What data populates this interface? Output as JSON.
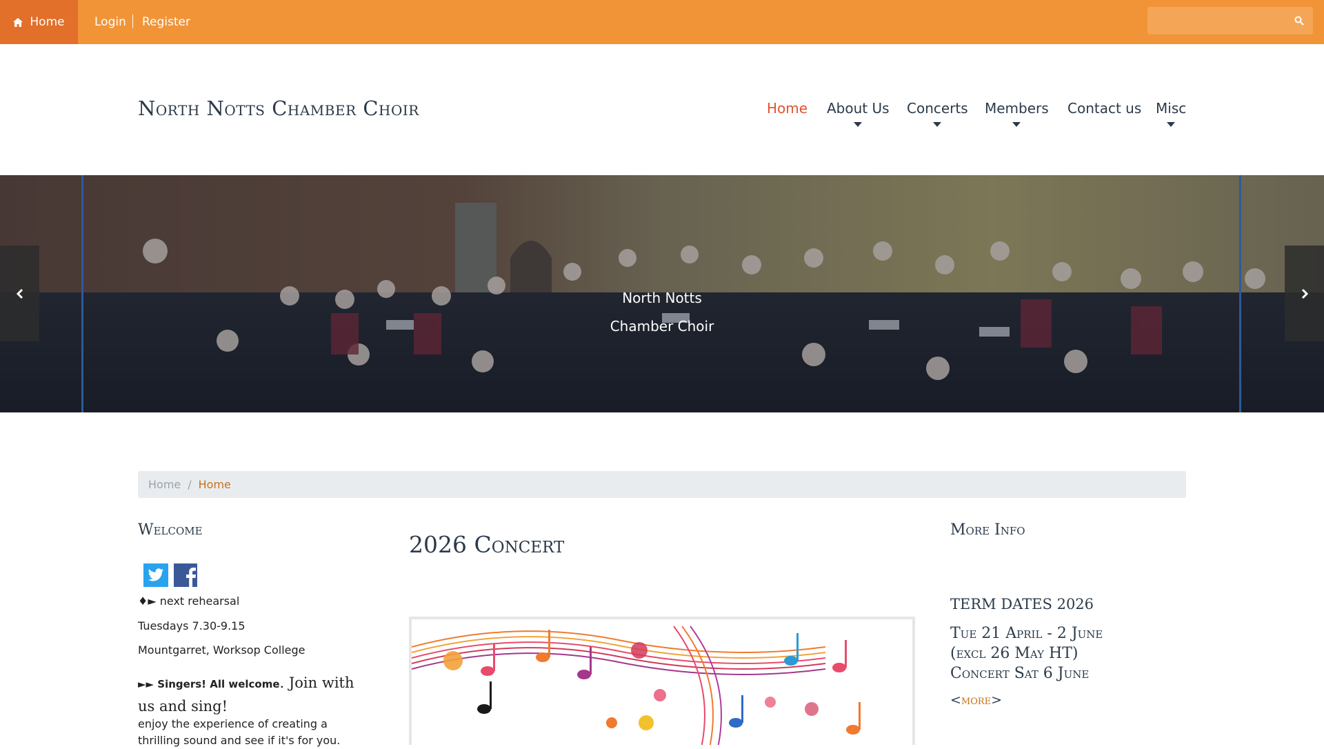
{
  "topbar": {
    "home_label": "Home",
    "login_label": "Login",
    "register_label": "Register",
    "search_placeholder": ""
  },
  "header": {
    "site_title": "North Notts Chamber Choir",
    "nav": [
      "Home",
      "About Us",
      "Concerts",
      "Members",
      "Contact us",
      "Misc"
    ],
    "active_nav": "Home"
  },
  "hero": {
    "caption_line1": "North Notts",
    "caption_line2": "Chamber Choir"
  },
  "breadcrumb": {
    "root": "Home",
    "separator": "/",
    "current": "Home"
  },
  "left": {
    "heading": "Welcome",
    "line1": "♦► next rehearsal",
    "line2": "Tuesdays 7.30-9.15",
    "line3": "Mountgarret, Worksop College",
    "line4_prefix": "►► Singers!  All welcome",
    "line4_suffix": ". Join with us and sing!",
    "line5": "enjoy the experience of creating a thrilling sound and see if it's for you."
  },
  "middle": {
    "heading": "2026 Concert"
  },
  "right": {
    "heading": "More Info",
    "term_title": "TERM DATES 2026",
    "term_line1": "Tue 21 April - 2 June",
    "term_line2": "(excl 26 May HT)",
    "term_line3": "Concert Sat 6 June",
    "more_open": "<",
    "more_label": "more",
    "more_close": ">"
  },
  "colors": {
    "topbar": "#f19437",
    "topbar_active": "#e2702a",
    "nav_active": "#e0532f",
    "link": "#c9711a",
    "heading": "#2b3a4a"
  }
}
